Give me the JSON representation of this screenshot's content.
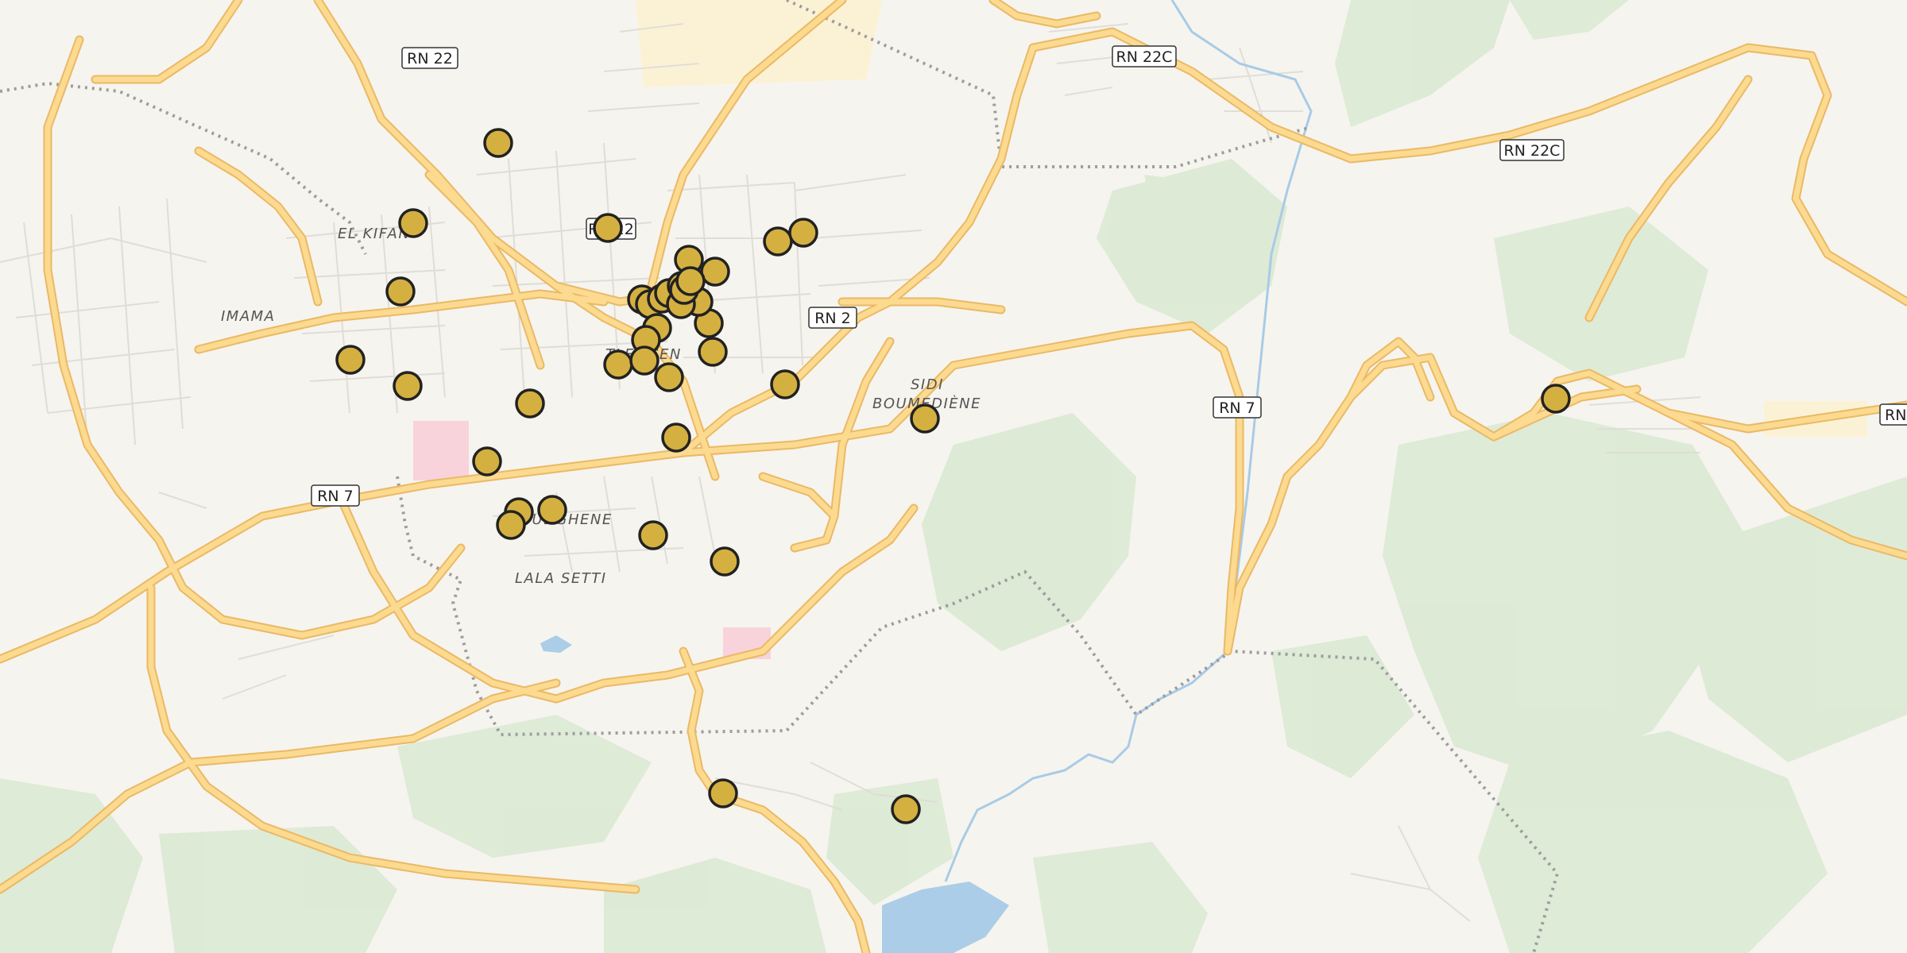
{
  "map": {
    "colors": {
      "background": "#f6f4ef",
      "road_major": "#fcd98a",
      "road_major_casing": "#e8b65a",
      "road_minor": "#dcdad6",
      "forest": "#d6e8cf",
      "water": "#a8cbe6",
      "boundary": "#9a9a9a",
      "marker_fill": "#d4b040",
      "marker_stroke": "#222222"
    },
    "road_labels": [
      "RN 22",
      "RN 22C",
      "RN 22C",
      "RN 2",
      "RN 7",
      "RN 7",
      "RN 22",
      "RN"
    ],
    "district_labels": [
      "EL KIFAN",
      "IMAMA",
      "SIDI",
      "BOUMEDIÈNE",
      "BOUDGHENE",
      "LALA SETTI",
      "TLEMCEN"
    ],
    "marker_icon": "circle-marker"
  }
}
